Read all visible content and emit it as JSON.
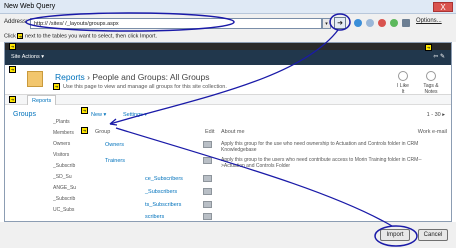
{
  "dialog": {
    "title": "New Web Query",
    "close_glyph": "X",
    "address_label": "Address:",
    "address_value": "http://                /sites/                  /_layouts/groups.aspx",
    "options_label": "Options...",
    "hint_prefix": "Click",
    "hint_text": "next to the tables you want to select, then click Import.",
    "import_label": "Import",
    "cancel_label": "Cancel"
  },
  "web": {
    "site_actions_label": "Site Actions ▾",
    "breadcrumb_site": "Reports",
    "breadcrumb_sep": " › ",
    "breadcrumb_page": "People and Groups: All Groups",
    "page_description": "Use this page to view and manage all groups for this site collection.",
    "i_like_it_label": "I Like It",
    "tags_label": "Tags & Notes",
    "tab_label": "Reports",
    "left_nav_title": "Groups",
    "left_nav_items": [
      "_Plants",
      "Members",
      "Owners",
      "Visitors",
      "_Subscrib",
      "_SD_Su",
      "ANGE_Su",
      "_Subscrib",
      "UC_Subs"
    ],
    "toolbar": {
      "new_label": "New ▾",
      "settings_label": "Settings ▾",
      "pager_label": "1 - 30 ▸"
    },
    "table": {
      "headers": {
        "group": "Group",
        "edit": "Edit",
        "about": "About me",
        "email": "Work e-mail"
      },
      "rows": [
        {
          "name": "Owners",
          "about": "Apply this group for the use who need ownership to Actuation and Controls folder in CRM Knowledgebase"
        },
        {
          "name": "Trainers",
          "about": "Apply this group to the users who need contribute access to Morin Training folder in CRM-->Actuation and Controls Folder"
        },
        {
          "name": "ce_Subscribers",
          "about": ""
        },
        {
          "name": "_Subscribers",
          "about": ""
        },
        {
          "name": "ts_Subscribers",
          "about": ""
        },
        {
          "name": "scribers",
          "about": ""
        }
      ]
    }
  },
  "colors": {
    "sharepoint_bar": "#21374c",
    "link_blue": "#0072bc",
    "marker_yellow": "#ffe600",
    "annotation_ink": "#1a1aa8"
  }
}
